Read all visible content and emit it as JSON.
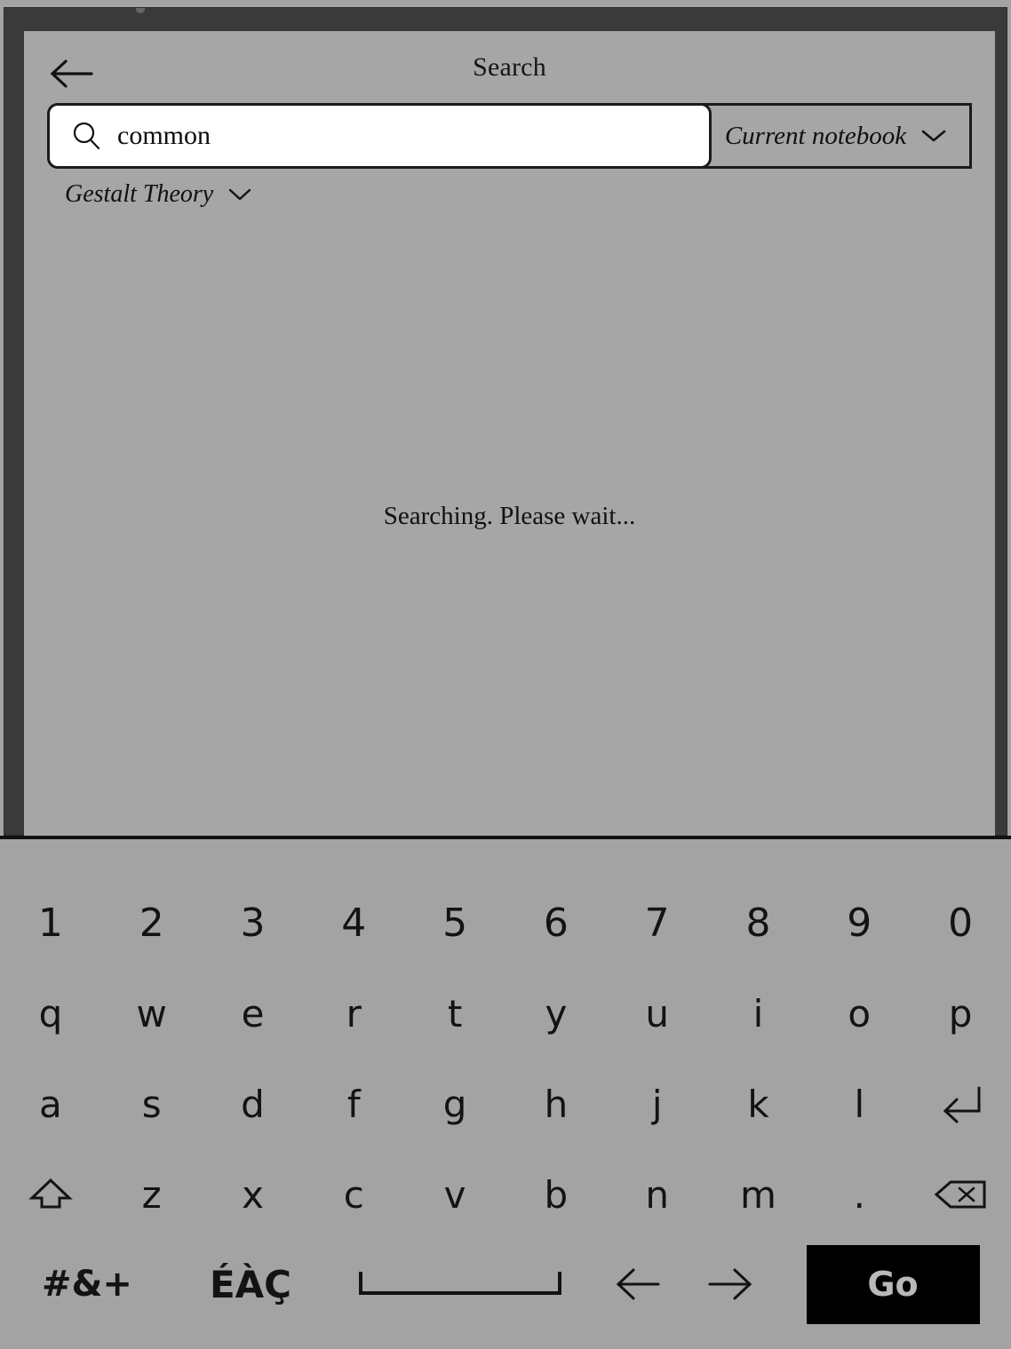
{
  "header": {
    "title": "Search",
    "back_icon": "arrow-left-icon"
  },
  "search": {
    "value": "common",
    "placeholder": "Search",
    "icon": "magnifier-icon",
    "scope_label": "Current notebook",
    "scope_chevron": "chevron-down-icon"
  },
  "filter": {
    "notebook_label": "Gestalt Theory",
    "chevron": "chevron-down-icon"
  },
  "status": {
    "message": "Searching. Please wait..."
  },
  "keyboard": {
    "row1": [
      "1",
      "2",
      "3",
      "4",
      "5",
      "6",
      "7",
      "8",
      "9",
      "0"
    ],
    "row2": [
      "q",
      "w",
      "e",
      "r",
      "t",
      "y",
      "u",
      "i",
      "o",
      "p"
    ],
    "row3": [
      "a",
      "s",
      "d",
      "f",
      "g",
      "h",
      "j",
      "k",
      "l"
    ],
    "row3_enter": "↵",
    "row4_shift": "⇧",
    "row4": [
      "z",
      "x",
      "c",
      "v",
      "b",
      "n",
      "m",
      "."
    ],
    "row4_backspace": "⌫",
    "symbols_key": "#&+",
    "accents_key": "ÉÀÇ",
    "space_key": "space-bar",
    "arrow_left": "←",
    "arrow_right": "→",
    "go_label": "Go"
  },
  "colors": {
    "page_background": "#a3a3a3",
    "content_background": "#a6a6a6",
    "bezel": "#3a3a3a",
    "ink": "#111111",
    "field_background": "#ffffff",
    "go_button_background": "#000000",
    "go_button_text": "#b9b9b9"
  }
}
